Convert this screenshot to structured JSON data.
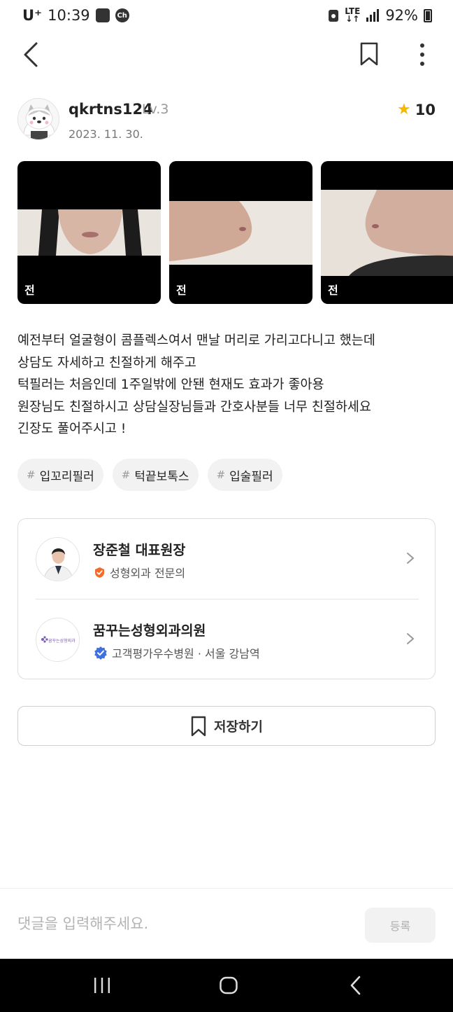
{
  "status_bar": {
    "carrier": "U⁺",
    "time": "10:39",
    "notif_app": "Ch",
    "network_line1": "LTE",
    "network_line2": "↓↑",
    "battery": "92%"
  },
  "post": {
    "username": "qkrtns124",
    "level": "Lv.3",
    "date": "2023. 11. 30.",
    "rating": "10",
    "photos": [
      {
        "label": "전"
      },
      {
        "label": "전"
      },
      {
        "label": "전"
      }
    ],
    "body_lines": [
      "예전부터 얼굴형이 콤플렉스여서 맨날 머리로 가리고다니고 했는데",
      "상담도 자세하고 친절하게 해주고",
      "턱필러는 처음인데 1주일밖에 안됀 현재도 효과가 좋아용",
      "원장님도 친절하시고 상담실장님들과 간호사분들 너무 친절하세요",
      "긴장도 풀어주시고 !"
    ],
    "tags": [
      {
        "hash": "#",
        "text": "입꼬리필러"
      },
      {
        "hash": "#",
        "text": "턱끝보톡스"
      },
      {
        "hash": "#",
        "text": "입술필러"
      }
    ]
  },
  "info_card": {
    "doctor": {
      "name": "장준철 대표원장",
      "specialty": "성형외과 전문의",
      "badge_color": "#F26B2A"
    },
    "clinic": {
      "name": "꿈꾸는성형외과의원",
      "logo_text": "꿈꾸는성형외과",
      "detail": "고객평가우수병원 · 서울 강남역",
      "badge_color": "#3D6FE0"
    }
  },
  "save_button": {
    "label": "저장하기"
  },
  "comment": {
    "placeholder": "댓글을 입력해주세요.",
    "submit_label": "등록"
  },
  "icons": {
    "back": "chevron-left-icon",
    "bookmark": "bookmark-icon",
    "more": "more-vertical-icon",
    "star": "star-icon",
    "chevron": "chevron-right-icon"
  }
}
